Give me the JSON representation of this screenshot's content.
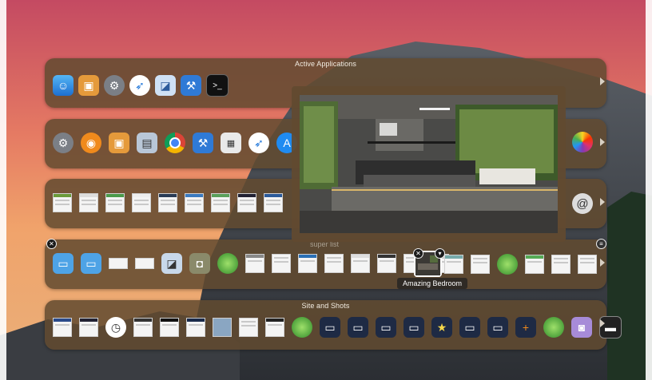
{
  "shelves": {
    "active": {
      "title": "Active Applications"
    },
    "sites": {
      "title": "Site and Shots"
    },
    "shelf5_hidden_label": "super list"
  },
  "tooltip": {
    "text": "Amazing Bedroom"
  },
  "icons": {
    "row1": [
      "finder-icon",
      "preview-icon",
      "system-preferences-icon",
      "safari-icon",
      "preview-photo-icon",
      "xcode-icon",
      "terminal-icon"
    ],
    "row2": [
      "system-preferences-icon",
      "airmail-icon",
      "preview-icon",
      "image-capture-icon",
      "chrome-icon",
      "xcode-icon",
      "calculator-icon",
      "safari-icon",
      "app-store-icon"
    ],
    "row2_right": [
      "photos-icon"
    ],
    "row3_right": [
      "mail-stamp-icon"
    ]
  },
  "colors": {
    "shelf_bg": "#624a30",
    "title_text": "#f2ece2"
  }
}
